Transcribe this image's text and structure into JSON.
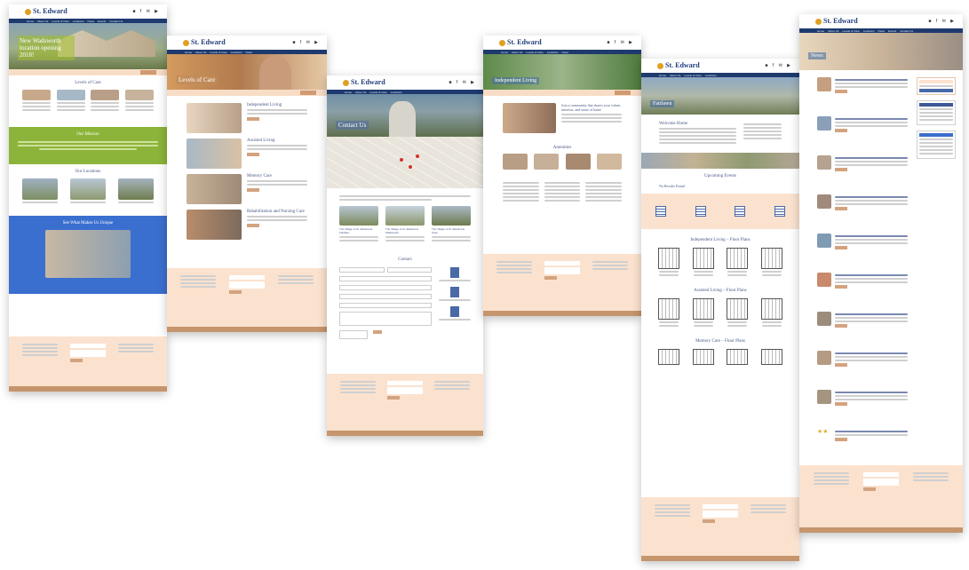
{
  "brand": {
    "logo_text": "St. Edward",
    "nav_items": [
      "Home",
      "About Us",
      "Levels of Care",
      "Locations",
      "News",
      "Events",
      "Contact Us"
    ]
  },
  "pages": {
    "home": {
      "hero_title": "New Wadsworth location opening 2018!",
      "section1": "Levels of Care",
      "section2": "Our Mission",
      "section3": "Our Locations",
      "section4": "See What Makes Us Unique"
    },
    "levels": {
      "hero_title": "Levels of Care",
      "items": [
        "Independent Living",
        "Assisted Living",
        "Memory Care",
        "Rehabilitation and Nursing Care"
      ]
    },
    "contact": {
      "hero_title": "Contact Us",
      "form_title": "Contact",
      "locations": [
        "The Village of St. Edward at Fairlawn",
        "The Village of St. Edward at Wadsworth",
        "The Village of St. Edward at Stow"
      ]
    },
    "independent": {
      "hero_title": "Independent Living",
      "intro_title": "Join a community that shares your values, interests, and sense of home",
      "amenities": "Amenities"
    },
    "fairlawn": {
      "hero_title": "Fairlawn",
      "welcome": "Welcome Home",
      "events": "Upcoming Events",
      "no_results": "No Results Found",
      "floor1": "Independent Living – Floor Plans",
      "floor2": "Assisted Living – Floor Plans",
      "floor3": "Memory Care – Floor Plans"
    },
    "news": {
      "hero_title": "News"
    }
  },
  "colors": {
    "navy": "#1e3a6e",
    "peach": "#fbe2cf",
    "tan": "#c5956c",
    "green": "#8cb43a",
    "blue": "#3b6fcf"
  }
}
